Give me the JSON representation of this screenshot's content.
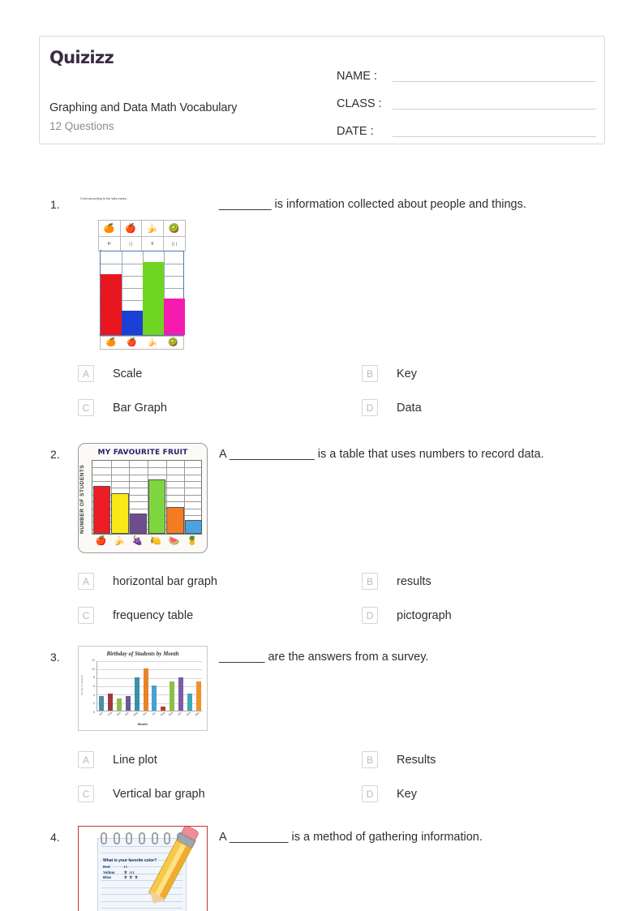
{
  "header": {
    "logo": "Quizizz",
    "title": "Graphing and Data Math Vocabulary",
    "subtitle": "12 Questions",
    "fields": [
      {
        "label": "NAME :",
        "value": ""
      },
      {
        "label": "CLASS :",
        "value": ""
      },
      {
        "label": "DATE  :",
        "value": ""
      }
    ]
  },
  "questions": [
    {
      "number": "1.",
      "text": "________ is information collected about people and things.",
      "options": [
        {
          "letter": "A",
          "label": "Scale"
        },
        {
          "letter": "B",
          "label": "Key"
        },
        {
          "letter": "C",
          "label": "Bar Graph"
        },
        {
          "letter": "D",
          "label": "Data"
        }
      ]
    },
    {
      "number": "2.",
      "text": "A _____________ is a table that uses numbers to record data.",
      "options": [
        {
          "letter": "A",
          "label": "horizontal bar graph"
        },
        {
          "letter": "B",
          "label": "results"
        },
        {
          "letter": "C",
          "label": "frequency table"
        },
        {
          "letter": "D",
          "label": "pictograph"
        }
      ]
    },
    {
      "number": "3.",
      "text": "_______ are the answers from a survey.",
      "options": [
        {
          "letter": "A",
          "label": "Line plot"
        },
        {
          "letter": "B",
          "label": "Results"
        },
        {
          "letter": "C",
          "label": "Vertical bar graph"
        },
        {
          "letter": "D",
          "label": "Key"
        }
      ]
    },
    {
      "number": "4.",
      "text": "A _________ is a method of gathering information.",
      "options": []
    }
  ],
  "chart_data": [
    {
      "type": "bar",
      "title": "Color according to the tally marks.",
      "categories": [
        "orange",
        "apple",
        "banana",
        "kiwi"
      ],
      "tally_marks": [
        "⥣∣",
        "∣∣",
        "⥣",
        "∣∣∣"
      ],
      "tally_text": [
        "5",
        "2",
        "6",
        "3"
      ],
      "values": [
        5,
        2,
        6,
        3
      ],
      "colors": [
        "#e8161f",
        "#1b3fd4",
        "#6fd520",
        "#f31bb0"
      ],
      "ylim": [
        0,
        7
      ],
      "yticks": [
        "7",
        "6",
        "5",
        "4",
        "3",
        "2",
        "1",
        "0"
      ],
      "icons": [
        "🍊",
        "🍎",
        "🍌",
        "🥝"
      ],
      "xlabel": "",
      "ylabel": "",
      "grid": true
    },
    {
      "type": "bar",
      "title": "MY FAVOURITE FRUIT",
      "ylabel": "NUMBER OF STUDENTS",
      "xlabel": "",
      "categories": [
        "apple",
        "banana",
        "grapes",
        "lemon",
        "watermelon",
        "pineapple"
      ],
      "values": [
        7,
        6,
        3,
        8,
        4,
        2
      ],
      "colors": [
        "#ee1c24",
        "#f9e814",
        "#6d4d8f",
        "#7ed63f",
        "#f47c20",
        "#4ba3e3"
      ],
      "ylim": [
        0,
        11
      ],
      "yticks": [
        "1",
        "2",
        "3",
        "4",
        "5",
        "6",
        "7",
        "8",
        "9",
        "10",
        "11"
      ],
      "icons": [
        "🍎",
        "🍌",
        "🍇",
        "🍋",
        "🍉",
        "🍍"
      ],
      "grid": true
    },
    {
      "type": "bar",
      "title": "Birthday of Students by Month",
      "xlabel": "Month",
      "ylabel": "Number of Students",
      "categories": [
        "Jan",
        "Feb",
        "Mar",
        "Apr",
        "May",
        "Jun",
        "Jul",
        "Aug",
        "Sep",
        "Oct",
        "Nov",
        "Dec"
      ],
      "values": [
        3.5,
        4,
        3,
        3.5,
        8,
        10,
        6,
        1,
        7,
        8,
        4,
        7
      ],
      "colors": [
        "#4a8fa8",
        "#9e3b3b",
        "#8cbf4a",
        "#6a5a96",
        "#3c8fa8",
        "#e8832a",
        "#4a9fd4",
        "#c0392b",
        "#8cbf4a",
        "#7d5ba6",
        "#3fa9b5",
        "#f0912d"
      ],
      "ylim": [
        0,
        12
      ],
      "yticks": [
        "0",
        "2",
        "4",
        "6",
        "8",
        "10",
        "12"
      ],
      "grid": true
    },
    {
      "type": "table",
      "title": "What is your favorite color?",
      "rows": [
        {
          "name": "Red",
          "tally": "II",
          "count": 2
        },
        {
          "name": "Yellow",
          "tally": "⥣ III",
          "count": 8
        },
        {
          "name": "Blue",
          "tally": "⥣ ⥣ ⥣",
          "count": 15
        }
      ]
    }
  ]
}
